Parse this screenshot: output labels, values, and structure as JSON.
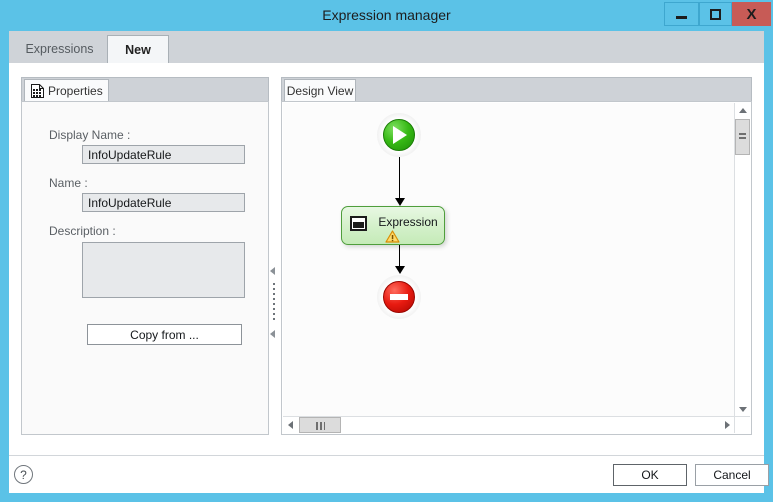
{
  "window": {
    "title": "Expression manager",
    "controls": {
      "minimize_label": "Minimize",
      "maximize_label": "Maximize",
      "close_label": "X"
    },
    "accent_color": "#5bc2e7",
    "close_color": "#c75b56"
  },
  "tabs": [
    {
      "label": "Expressions",
      "active": false
    },
    {
      "label": "New",
      "active": true
    }
  ],
  "properties_panel": {
    "tab_label": "Properties",
    "tab_icon": "grid-document-icon",
    "fields": {
      "display_name_label": "Display Name :",
      "display_name_value": "InfoUpdateRule",
      "name_label": "Name :",
      "name_value": "InfoUpdateRule",
      "description_label": "Description :",
      "description_value": ""
    },
    "copy_from_label": "Copy from ..."
  },
  "splitter": {
    "collapse_icon_top": "triangle-left-icon",
    "collapse_icon_bottom": "triangle-left-icon",
    "grip": "dotted-grip"
  },
  "design_panel": {
    "tab_label": "Design View",
    "flow": {
      "start_node": {
        "type": "start",
        "icon": "play-icon",
        "color": "#37b915"
      },
      "expression_node": {
        "label": "Expression",
        "icon": "expression-icon",
        "warning_icon": "warning-triangle-icon",
        "fill_color": "#d3f0c9",
        "border_color": "#4f9e3c"
      },
      "stop_node": {
        "type": "stop",
        "icon": "stop-bar-icon",
        "color": "#e81b11"
      },
      "connectors": 2
    },
    "vertical_scrollbar": {
      "up_icon": "caret-up-icon",
      "down_icon": "caret-down-icon",
      "thumb": "scroll-thumb"
    },
    "horizontal_scrollbar": {
      "left_icon": "caret-left-icon",
      "right_icon": "caret-right-icon",
      "thumb": "scroll-thumb"
    }
  },
  "footer": {
    "help_icon": "question-mark-icon",
    "help_glyph": "?",
    "ok_label": "OK",
    "cancel_label": "Cancel"
  }
}
